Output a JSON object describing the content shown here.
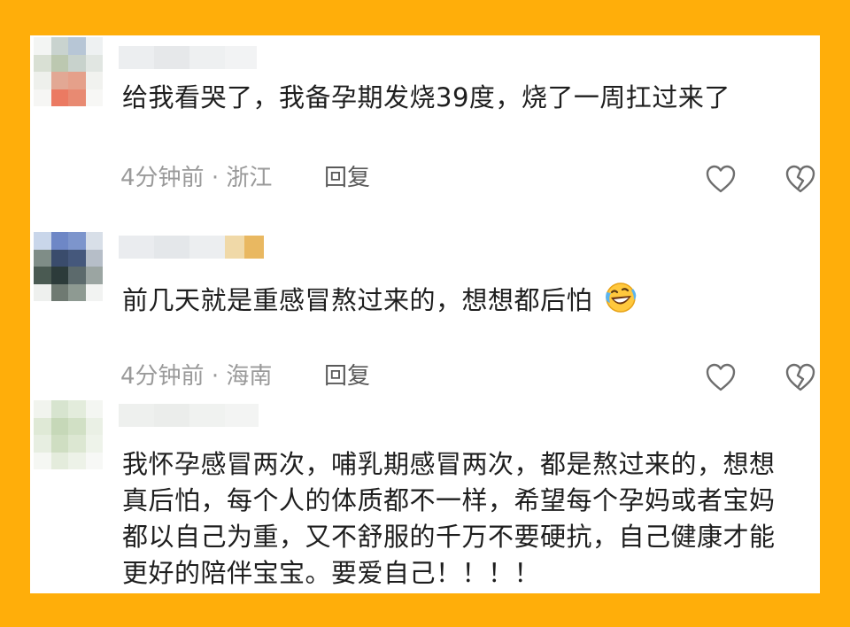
{
  "comments": [
    {
      "text": "给我看哭了，我备孕期发烧39度，烧了一周扛过来了",
      "time": "4分钟前",
      "separator": "·",
      "location": "浙江",
      "reply_label": "回复",
      "like_icon": "heart-outline-icon",
      "dislike_icon": "broken-heart-icon"
    },
    {
      "text": "前几天就是重感冒熬过来的，想想都后怕",
      "emoji": "laughing-crying-emoji",
      "time": "4分钟前",
      "separator": "·",
      "location": "海南",
      "reply_label": "回复",
      "like_icon": "heart-outline-icon",
      "dislike_icon": "broken-heart-icon"
    },
    {
      "text": "我怀孕感冒两次，哺乳期感冒两次，都是熬过来的，想想真后怕，每个人的体质都不一样，希望每个孕妈或者宝妈都以自己为重，又不舒服的千万不要硬抗，自己健康才能更好的陪伴宝宝。要爱自己！！！！"
    }
  ],
  "colors": {
    "frame": "#FFAE0A",
    "text": "#1e1e1e",
    "meta": "#9a9a9a",
    "reply": "#5a5a5a"
  }
}
